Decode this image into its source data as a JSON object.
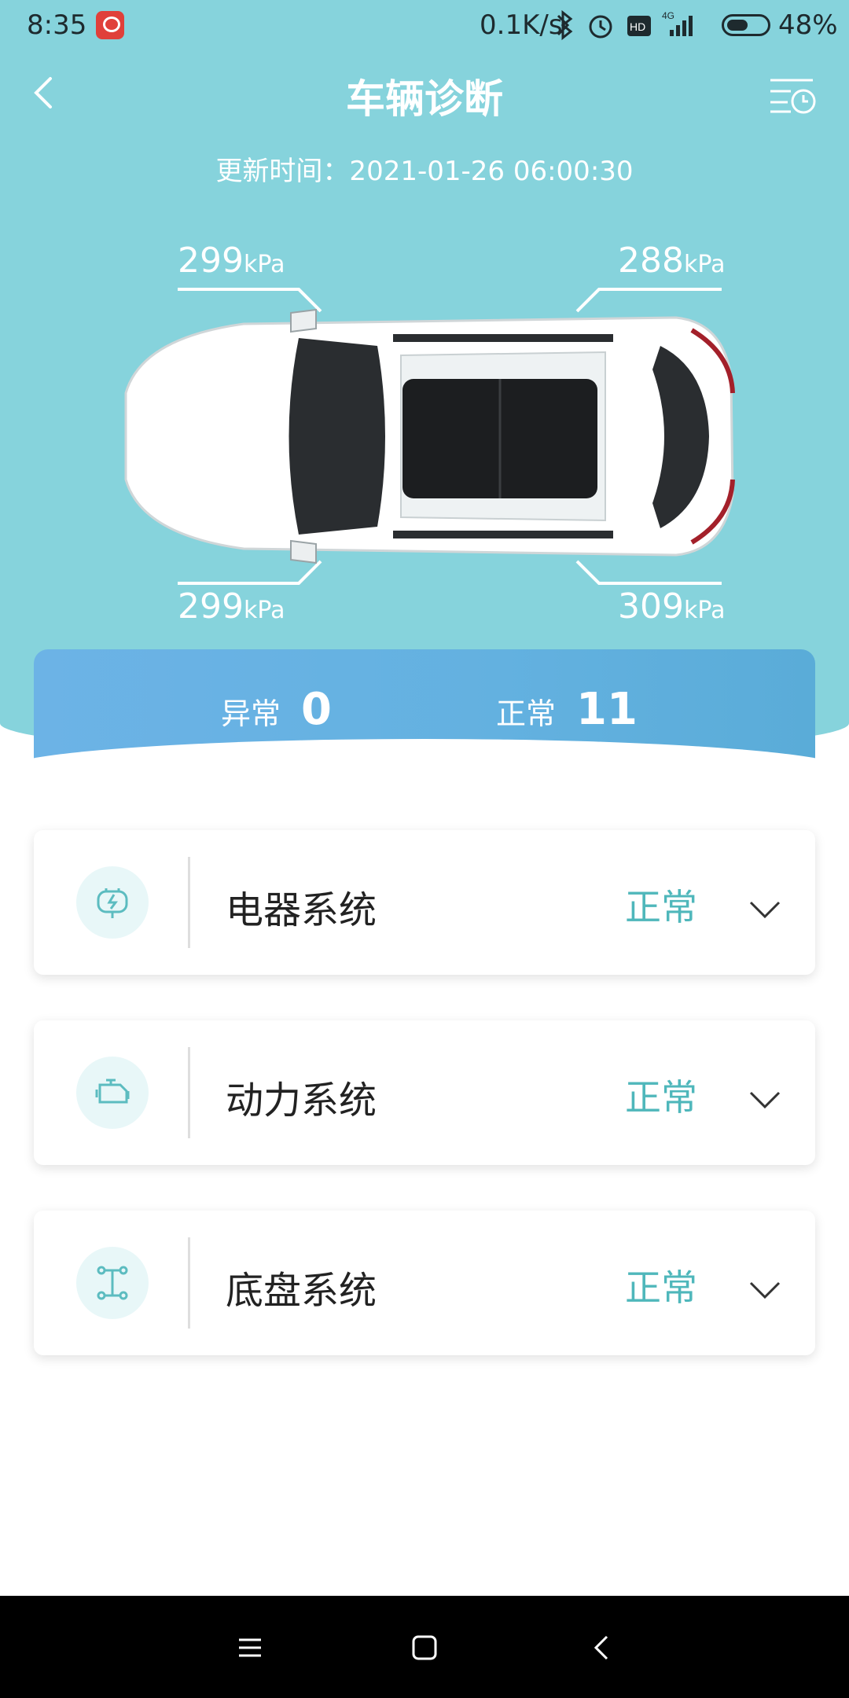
{
  "status_bar": {
    "time": "8:35",
    "net_speed": "0.1K/s",
    "network": "4G",
    "hd_badge": "HD",
    "battery_percent": "48%",
    "battery_level": 0.48
  },
  "header": {
    "title": "车辆诊断",
    "update_time": "更新时间：2021-01-26 06:00:30"
  },
  "tires": {
    "unit": "kPa",
    "front_left": "299",
    "front_right": "288",
    "rear_left": "299",
    "rear_right": "309"
  },
  "summary": {
    "abnormal_label": "异常",
    "abnormal_count": "0",
    "normal_label": "正常",
    "normal_count": "11"
  },
  "systems": [
    {
      "name": "电器系统",
      "status": "正常",
      "icon": "battery-electric-icon"
    },
    {
      "name": "动力系统",
      "status": "正常",
      "icon": "engine-icon"
    },
    {
      "name": "底盘系统",
      "status": "正常",
      "icon": "chassis-icon"
    }
  ],
  "colors": {
    "hero_bg": "#86d3dc",
    "status_ok": "#4fb7bb",
    "summary_bar": "#63b1e0"
  }
}
